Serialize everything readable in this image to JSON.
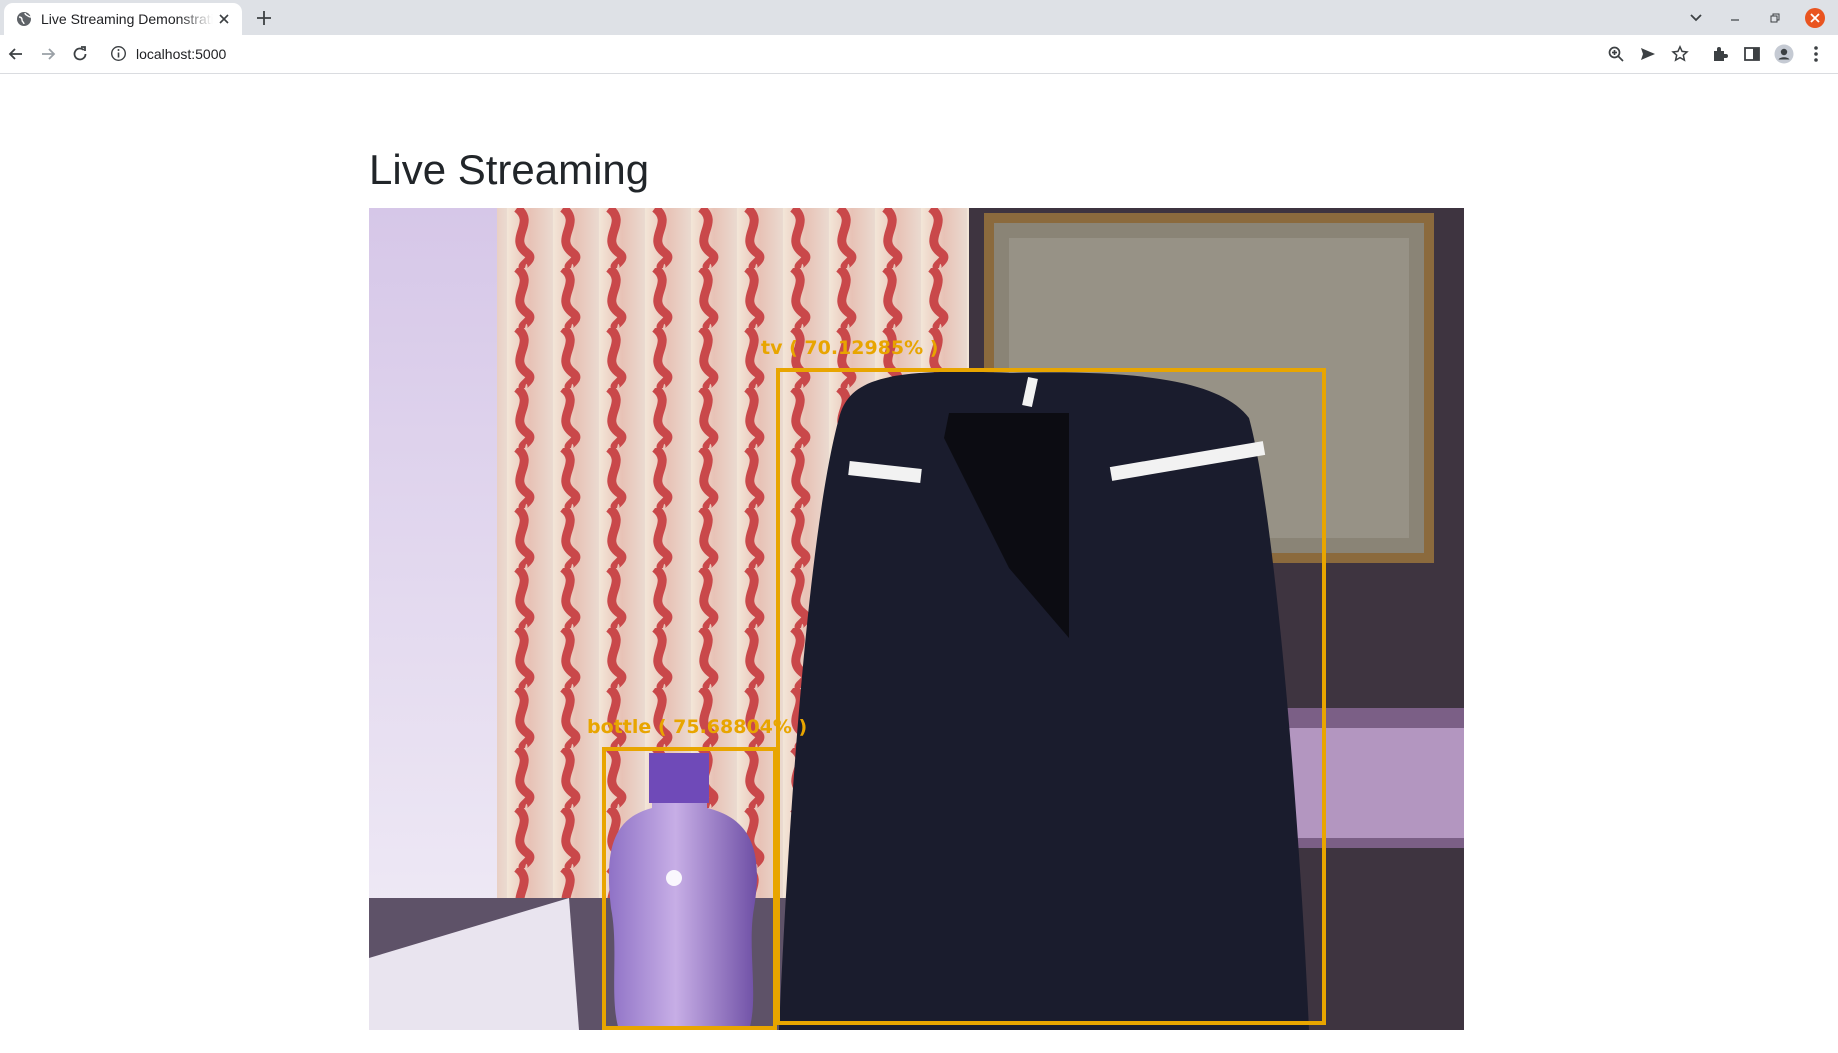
{
  "browser": {
    "tab_title": "Live Streaming Demonstration",
    "url": "localhost:5000",
    "icons": {
      "tab_favicon": "globe-icon",
      "tab_close": "close-icon",
      "new_tab": "plus-icon",
      "tab_search": "chevron-down-icon",
      "back": "arrow-left-icon",
      "forward": "arrow-right-icon",
      "reload": "reload-icon",
      "site_info": "info-icon",
      "zoom": "zoom-icon",
      "send": "send-icon",
      "bookmark": "star-icon",
      "extensions": "puzzle-icon",
      "side_panel": "side-panel-icon",
      "profile": "profile-icon",
      "menu": "kebab-menu-icon"
    }
  },
  "page": {
    "title": "Live Streaming"
  },
  "stream": {
    "detections": [
      {
        "label": "tv ( 70.12985% )",
        "class": "tv"
      },
      {
        "label": "bottle ( 75.68804% )",
        "class": "bottle"
      }
    ],
    "box_color": "#e8a500"
  }
}
